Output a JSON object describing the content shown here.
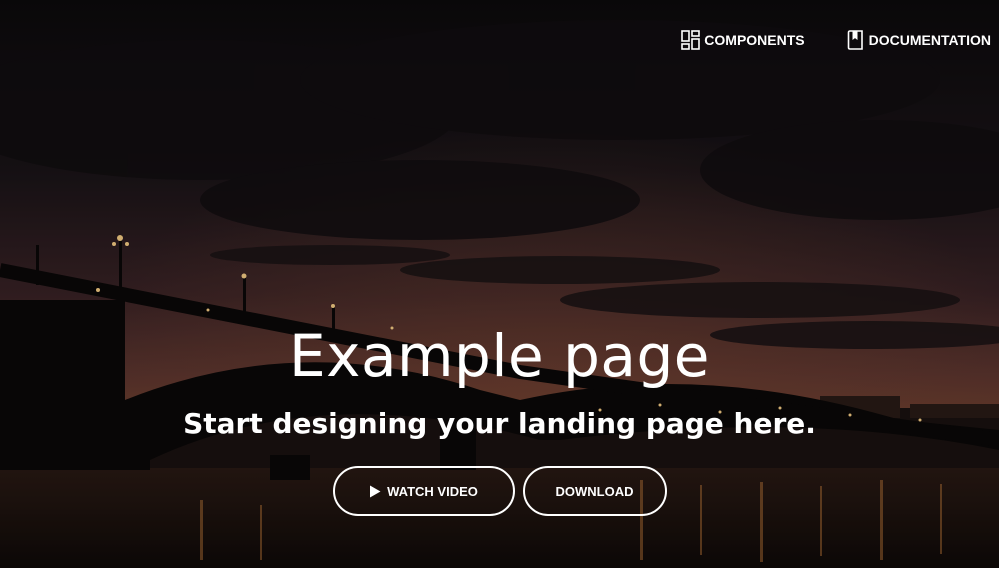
{
  "nav": {
    "components_label": "COMPONENTS",
    "components_icon": "dashboard-icon",
    "documentation_label": "DOCUMENTATION",
    "documentation_icon": "book-icon"
  },
  "hero": {
    "title": "Example page",
    "subtitle": "Start designing your landing page here.",
    "watch_label": "WATCH VIDEO",
    "watch_icon": "play-icon",
    "download_label": "DOWNLOAD"
  },
  "colors": {
    "text": "#ffffff",
    "sky_dark": "#0f0c10",
    "sky_glow": "#6b3a33",
    "water": "#1a1210"
  }
}
